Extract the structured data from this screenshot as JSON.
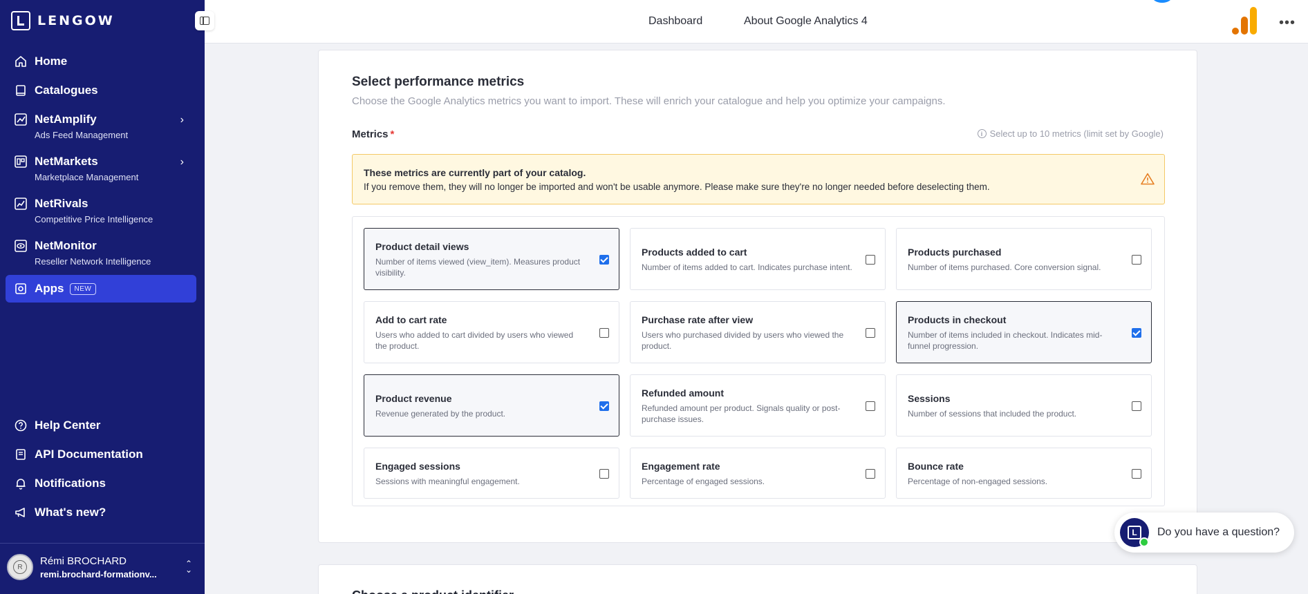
{
  "sidebar": {
    "logo_text": "LENGOW",
    "nav": [
      {
        "label": "Home",
        "sub": ""
      },
      {
        "label": "Catalogues",
        "sub": ""
      },
      {
        "label": "NetAmplify",
        "sub": "Ads Feed Management"
      },
      {
        "label": "NetMarkets",
        "sub": "Marketplace Management"
      },
      {
        "label": "NetRivals",
        "sub": "Competitive Price Intelligence"
      },
      {
        "label": "NetMonitor",
        "sub": "Reseller Network Intelligence"
      },
      {
        "label": "Apps",
        "badge": "NEW"
      }
    ],
    "bottom": [
      {
        "label": "Help Center"
      },
      {
        "label": "API Documentation"
      },
      {
        "label": "Notifications"
      },
      {
        "label": "What's new?"
      }
    ],
    "user": {
      "name": "Rémi BROCHARD",
      "email": "remi.brochard-formationv..."
    }
  },
  "topbar": {
    "tabs": [
      "Dashboard",
      "About Google Analytics 4"
    ]
  },
  "section": {
    "title": "Select performance metrics",
    "description": "Choose the Google Analytics metrics you want to import. These will enrich your catalogue and help you optimize your campaigns.",
    "metrics_label": "Metrics",
    "required_mark": "*",
    "limit_hint": "Select up to 10 metrics (limit set by Google)"
  },
  "alert": {
    "title": "These metrics are currently part of your catalog.",
    "text": "If you remove them, they will no longer be imported and won't be usable anymore. Please make sure they're no longer needed before deselecting them."
  },
  "metrics": [
    {
      "title": "Product detail views",
      "desc": "Number of items viewed (view_item). Measures product visibility.",
      "checked": true
    },
    {
      "title": "Products added to cart",
      "desc": "Number of items added to cart. Indicates purchase intent.",
      "checked": false
    },
    {
      "title": "Products purchased",
      "desc": "Number of items purchased. Core conversion signal.",
      "checked": false
    },
    {
      "title": "Add to cart rate",
      "desc": "Users who added to cart divided by users who viewed the product.",
      "checked": false
    },
    {
      "title": "Purchase rate after view",
      "desc": "Users who purchased divided by users who viewed the product.",
      "checked": false
    },
    {
      "title": "Products in checkout",
      "desc": "Number of items included in checkout. Indicates mid-funnel progression.",
      "checked": true
    },
    {
      "title": "Product revenue",
      "desc": "Revenue generated by the product.",
      "checked": true
    },
    {
      "title": "Refunded amount",
      "desc": "Refunded amount per product. Signals quality or post-purchase issues.",
      "checked": false
    },
    {
      "title": "Sessions",
      "desc": "Number of sessions that included the product.",
      "checked": false
    },
    {
      "title": "Engaged sessions",
      "desc": "Sessions with meaningful engagement.",
      "checked": false
    },
    {
      "title": "Engagement rate",
      "desc": "Percentage of engaged sessions.",
      "checked": false
    },
    {
      "title": "Bounce rate",
      "desc": "Percentage of non-engaged sessions.",
      "checked": false
    }
  ],
  "next_section_title": "Choose a product identifier",
  "chat": {
    "text": "Do you have a question?"
  },
  "colors": {
    "sidebar": "#171d72",
    "active": "#3140d8",
    "checkbox": "#1f6feb",
    "alert_bg": "#fff8e1"
  }
}
